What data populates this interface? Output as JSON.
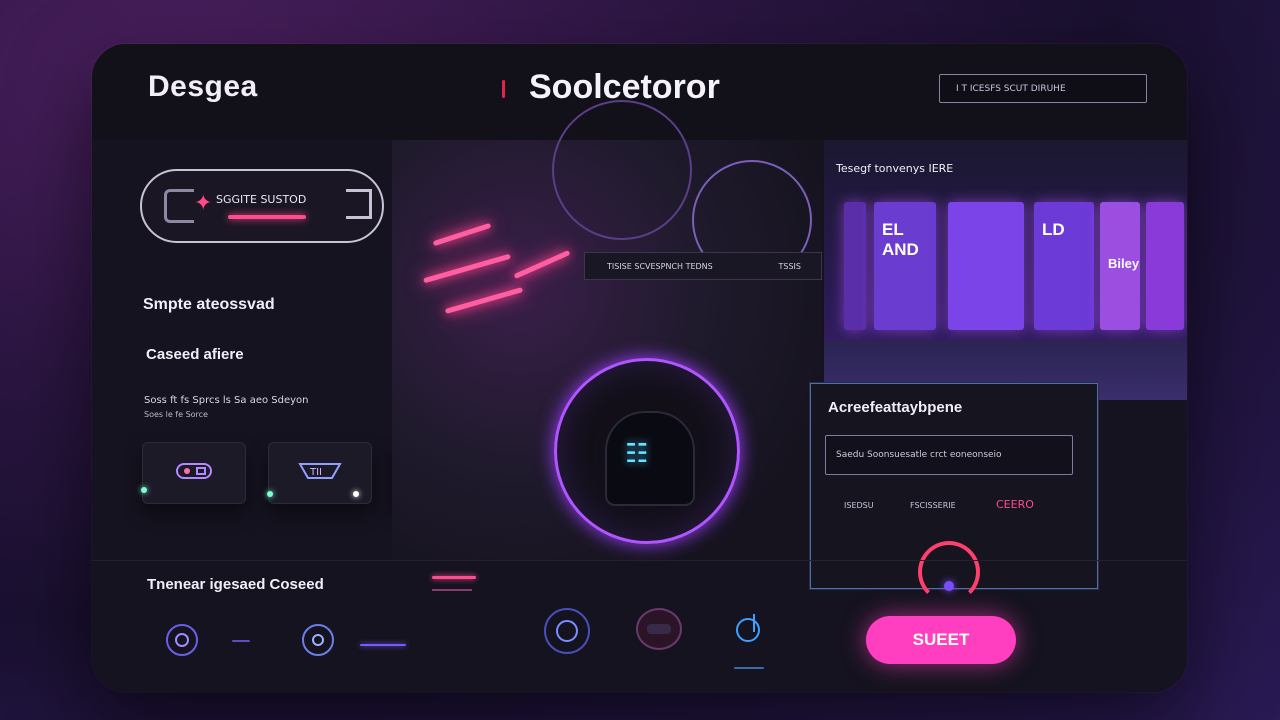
{
  "header": {
    "brand": "Desgea",
    "title": "Soolcetoror",
    "search_text": "I T ICESFS SCUT DIRUHE"
  },
  "toggle": {
    "label": "SGGITE SUSTOD"
  },
  "left": {
    "heading": "Smpte ateossvad",
    "subheading": "Caseed afiere",
    "text1": "Soss ft fs Sprcs ls Sa aeo Sdeyon",
    "text2": "Soes le fe Sorce"
  },
  "center": {
    "strip_left": "TISISE SCVESPNCH TEDNS",
    "strip_right": "TSSIS"
  },
  "store": {
    "title": "Tesegf tonvenys IERE",
    "cards": [
      "EL AND",
      "",
      "LD",
      "Biley",
      ""
    ]
  },
  "dialog": {
    "title": "Acreefeattaybpene",
    "input_text": "Saedu Soonsuesatle crct eoneonseio",
    "opt1": "ISEDSU",
    "opt2": "FSCISSERIE",
    "opt3": "CEERO"
  },
  "bottom": {
    "title": "Tnenear igesaed Coseed"
  },
  "start_button": "SUEET",
  "colors": {
    "accent_pink": "#ff3fbf",
    "neon_purple": "#b055ff",
    "panel_bg": "#15131f"
  }
}
